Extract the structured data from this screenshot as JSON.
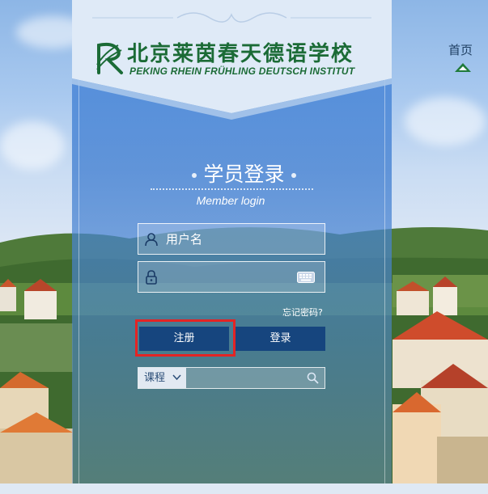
{
  "nav": {
    "home_label": "首页"
  },
  "brand": {
    "title_cn": "北京莱茵春天德语学校",
    "title_en": "PEKING RHEIN FRÜHLING DEUTSCH INSTITUT",
    "green": "#1b6b36"
  },
  "login": {
    "title": "学员登录",
    "subtitle": "Member login",
    "username_placeholder": "用户名",
    "password_placeholder": "",
    "forgot_label": "忘记密码?",
    "register_label": "注册",
    "login_label": "登录",
    "button_color": "#16457e",
    "highlight_color": "#e42424"
  },
  "search": {
    "select_value": "课程",
    "query": ""
  },
  "icons": {
    "user": "user-icon",
    "lock": "lock-icon",
    "keyboard": "keyboard-icon",
    "search": "search-icon",
    "chevron": "chevron-down-icon",
    "home_arrow": "home-up-arrow-icon"
  }
}
